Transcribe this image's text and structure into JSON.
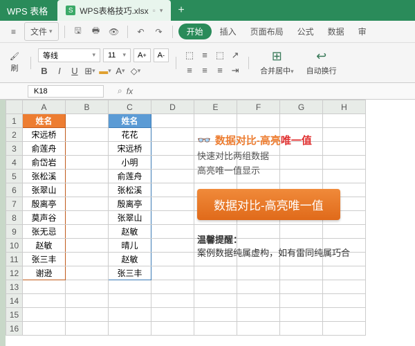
{
  "titlebar": {
    "app": "WPS 表格",
    "tab": "WPS表格技巧.xlsx",
    "add": "+"
  },
  "menu": {
    "hamburger": "≡",
    "file": "文件",
    "start": "开始",
    "insert": "插入",
    "layout": "页面布局",
    "formula": "公式",
    "data": "数据",
    "review": "审"
  },
  "toolbar": {
    "brush": "刷",
    "font": "等线",
    "size": "11",
    "merge": "合并居中",
    "wrap": "自动换行",
    "bold": "B",
    "italic": "I",
    "underline": "U",
    "fontup": "A",
    "fontdn": "A"
  },
  "formula": {
    "cell": "K18",
    "fx": "fx"
  },
  "cols": [
    "A",
    "B",
    "C",
    "D",
    "E",
    "F",
    "G",
    "H"
  ],
  "rows": [
    "1",
    "2",
    "3",
    "4",
    "5",
    "6",
    "7",
    "8",
    "9",
    "10",
    "11",
    "12",
    "13",
    "14",
    "15",
    "16"
  ],
  "hdr": {
    "a": "姓名",
    "c": "姓名"
  },
  "colA": [
    "宋远桥",
    "俞莲舟",
    "俞岱岩",
    "张松溪",
    "张翠山",
    "殷离亭",
    "莫声谷",
    "张无忌",
    "赵敏",
    "张三丰",
    "谢逊"
  ],
  "colC": [
    "花花",
    "宋远桥",
    "小明",
    "俞莲舟",
    "张松溪",
    "殷离亭",
    "张翠山",
    "赵敏",
    "晴儿",
    "赵敏",
    "张三丰"
  ],
  "overlay": {
    "title1": "数据对比-高亮",
    "title2": "唯一值",
    "sub1": "快速对比两组数据",
    "sub2": "高亮唯一值显示",
    "btn": "数据对比-高亮唯一值",
    "warn_title": "温馨提醒：",
    "warn_body": "案例数据纯属虚构，如有雷同纯属巧合"
  }
}
